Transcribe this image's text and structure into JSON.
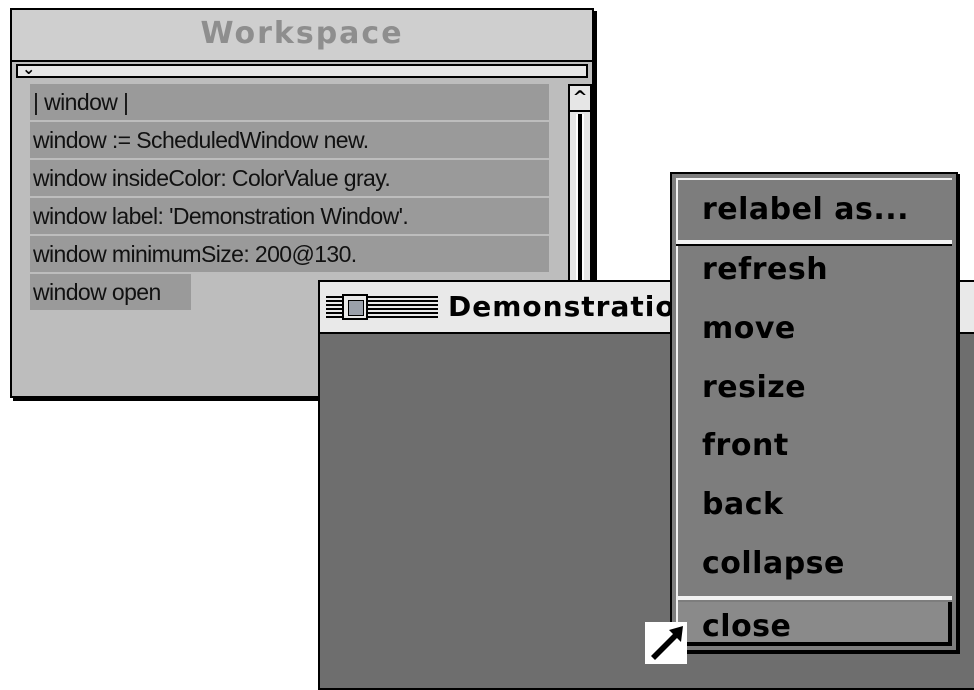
{
  "workspace": {
    "title": "Workspace",
    "code_lines": [
      "| window |",
      "window := ScheduledWindow new.",
      "window insideColor: ColorValue gray.",
      "window label: 'Demonstration Window'.",
      "window minimumSize: 200@130.",
      "window open"
    ]
  },
  "demo_window": {
    "title": "Demonstratio"
  },
  "popup_menu": {
    "items": [
      "relabel as...",
      "refresh",
      "move",
      "resize",
      "front",
      "back",
      "collapse",
      "close"
    ],
    "highlighted": "close"
  },
  "icons": {
    "menu_chevron": "chevron-down-icon",
    "scroll_up": "scroll-up-arrow-icon",
    "cursor": "mouse-pointer-icon"
  },
  "colors": {
    "window_bg": "#bdbdbd",
    "selection": "#9a9a9a",
    "demo_inside": "#6e6e6e",
    "menu_bg": "#7d7d7d"
  }
}
